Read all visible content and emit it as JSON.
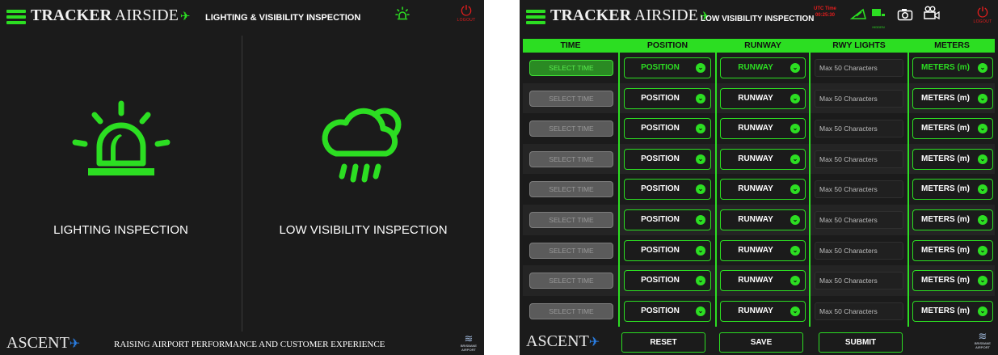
{
  "brand": {
    "name_bold": "TRACKER",
    "name_light": "AIRSIDE",
    "plane_icon": "airplane-icon"
  },
  "colors": {
    "accent": "#2cde22",
    "background": "#1b1b1b",
    "alert": "#e81d1d",
    "button_disabled": "#5b5b5b"
  },
  "screen1": {
    "title": "LIGHTING & VISIBILITY INSPECTION",
    "beacon_icon": "beacon-light-icon",
    "logout_label": "LOGOUT",
    "panels": [
      {
        "label": "LIGHTING INSPECTION",
        "icon": "beacon-light-icon"
      },
      {
        "label": "LOW VISIBILITY INSPECTION",
        "icon": "cloud-rain-sun-icon"
      }
    ],
    "footer": {
      "company": "ASCENT",
      "tagline": "RAISING AIRPORT PERFORMANCE AND CUSTOMER EXPERIENCE",
      "airport_line1": "BRISBANE",
      "airport_line2": "AIRPORT"
    }
  },
  "screen2": {
    "title": "LOW VISIBILITY INSPECTION",
    "utc_label": "UTC Time",
    "utc_time": "00:25:30",
    "logout_label": "LOGOUT",
    "hidden_label": "HIDDEN",
    "columns": [
      "TIME",
      "POSITION",
      "RUNWAY",
      "RWY LIGHTS",
      "METERS"
    ],
    "rows": [
      {
        "time": "SELECT TIME",
        "position": "POSITION",
        "runway": "RUNWAY",
        "rwy_lights_placeholder": "Max 50 Characters",
        "meters": "METERS (m)"
      },
      {
        "time": "SELECT TIME",
        "position": "POSITION",
        "runway": "RUNWAY",
        "rwy_lights_placeholder": "Max 50 Characters",
        "meters": "METERS (m)"
      },
      {
        "time": "SELECT TIME",
        "position": "POSITION",
        "runway": "RUNWAY",
        "rwy_lights_placeholder": "Max 50 Characters",
        "meters": "METERS (m)"
      },
      {
        "time": "SELECT TIME",
        "position": "POSITION",
        "runway": "RUNWAY",
        "rwy_lights_placeholder": "Max 50 Characters",
        "meters": "METERS (m)"
      },
      {
        "time": "SELECT TIME",
        "position": "POSITION",
        "runway": "RUNWAY",
        "rwy_lights_placeholder": "Max 50 Characters",
        "meters": "METERS (m)"
      },
      {
        "time": "SELECT TIME",
        "position": "POSITION",
        "runway": "RUNWAY",
        "rwy_lights_placeholder": "Max 50 Characters",
        "meters": "METERS (m)"
      },
      {
        "time": "SELECT TIME",
        "position": "POSITION",
        "runway": "RUNWAY",
        "rwy_lights_placeholder": "Max 50 Characters",
        "meters": "METERS (m)"
      },
      {
        "time": "SELECT TIME",
        "position": "POSITION",
        "runway": "RUNWAY",
        "rwy_lights_placeholder": "Max 50 Characters",
        "meters": "METERS (m)"
      },
      {
        "time": "SELECT TIME",
        "position": "POSITION",
        "runway": "RUNWAY",
        "rwy_lights_placeholder": "Max 50 Characters",
        "meters": "METERS (m)"
      }
    ],
    "buttons": {
      "reset": "RESET",
      "save": "SAVE",
      "submit": "SUBMIT"
    },
    "footer": {
      "company": "ASCENT",
      "airport_line1": "BRISBANE",
      "airport_line2": "AIRPORT"
    }
  }
}
